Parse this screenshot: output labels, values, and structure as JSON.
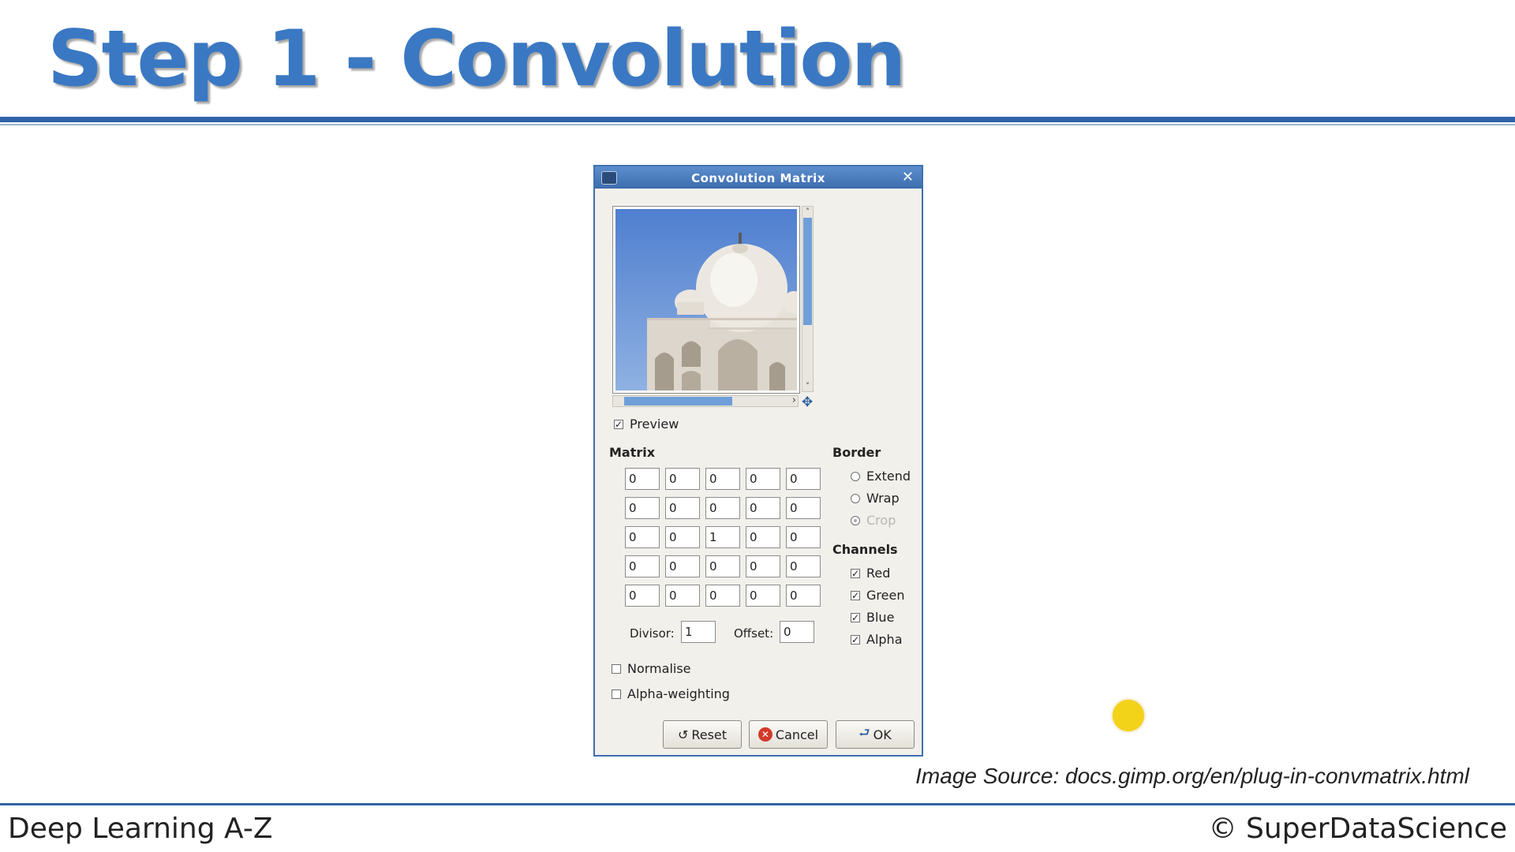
{
  "slide": {
    "title": "Step 1 - Convolution",
    "image_source": "Image Source: docs.gimp.org/en/plug-in-convmatrix.html",
    "footer_left": "Deep Learning A-Z",
    "footer_right": "© SuperDataScience"
  },
  "dialog": {
    "title": "Convolution Matrix",
    "preview_label": "Preview",
    "preview_checked": true,
    "matrix_label": "Matrix",
    "matrix": [
      [
        "0",
        "0",
        "0",
        "0",
        "0"
      ],
      [
        "0",
        "0",
        "0",
        "0",
        "0"
      ],
      [
        "0",
        "0",
        "1",
        "0",
        "0"
      ],
      [
        "0",
        "0",
        "0",
        "0",
        "0"
      ],
      [
        "0",
        "0",
        "0",
        "0",
        "0"
      ]
    ],
    "divisor_label": "Divisor:",
    "divisor_value": "1",
    "offset_label": "Offset:",
    "offset_value": "0",
    "normalise_label": "Normalise",
    "normalise_checked": false,
    "alpha_weighting_label": "Alpha-weighting",
    "alpha_weighting_checked": false,
    "border_label": "Border",
    "border_options": [
      {
        "label": "Extend",
        "selected": false,
        "disabled": false
      },
      {
        "label": "Wrap",
        "selected": false,
        "disabled": false
      },
      {
        "label": "Crop",
        "selected": true,
        "disabled": true
      }
    ],
    "channels_label": "Channels",
    "channels": [
      {
        "label": "Red",
        "checked": true
      },
      {
        "label": "Green",
        "checked": true
      },
      {
        "label": "Blue",
        "checked": true
      },
      {
        "label": "Alpha",
        "checked": true
      }
    ],
    "buttons": {
      "reset": "Reset",
      "cancel": "Cancel",
      "ok": "OK"
    },
    "icons": {
      "window": "window-menu-icon",
      "close": "close-icon",
      "navigate": "navigate-icon"
    }
  },
  "colors": {
    "title_blue": "#3a78c3",
    "rule_blue": "#2f63a8",
    "titlebar_blue": "#4c7dbf",
    "cursor_yellow": "#f3d21a"
  }
}
